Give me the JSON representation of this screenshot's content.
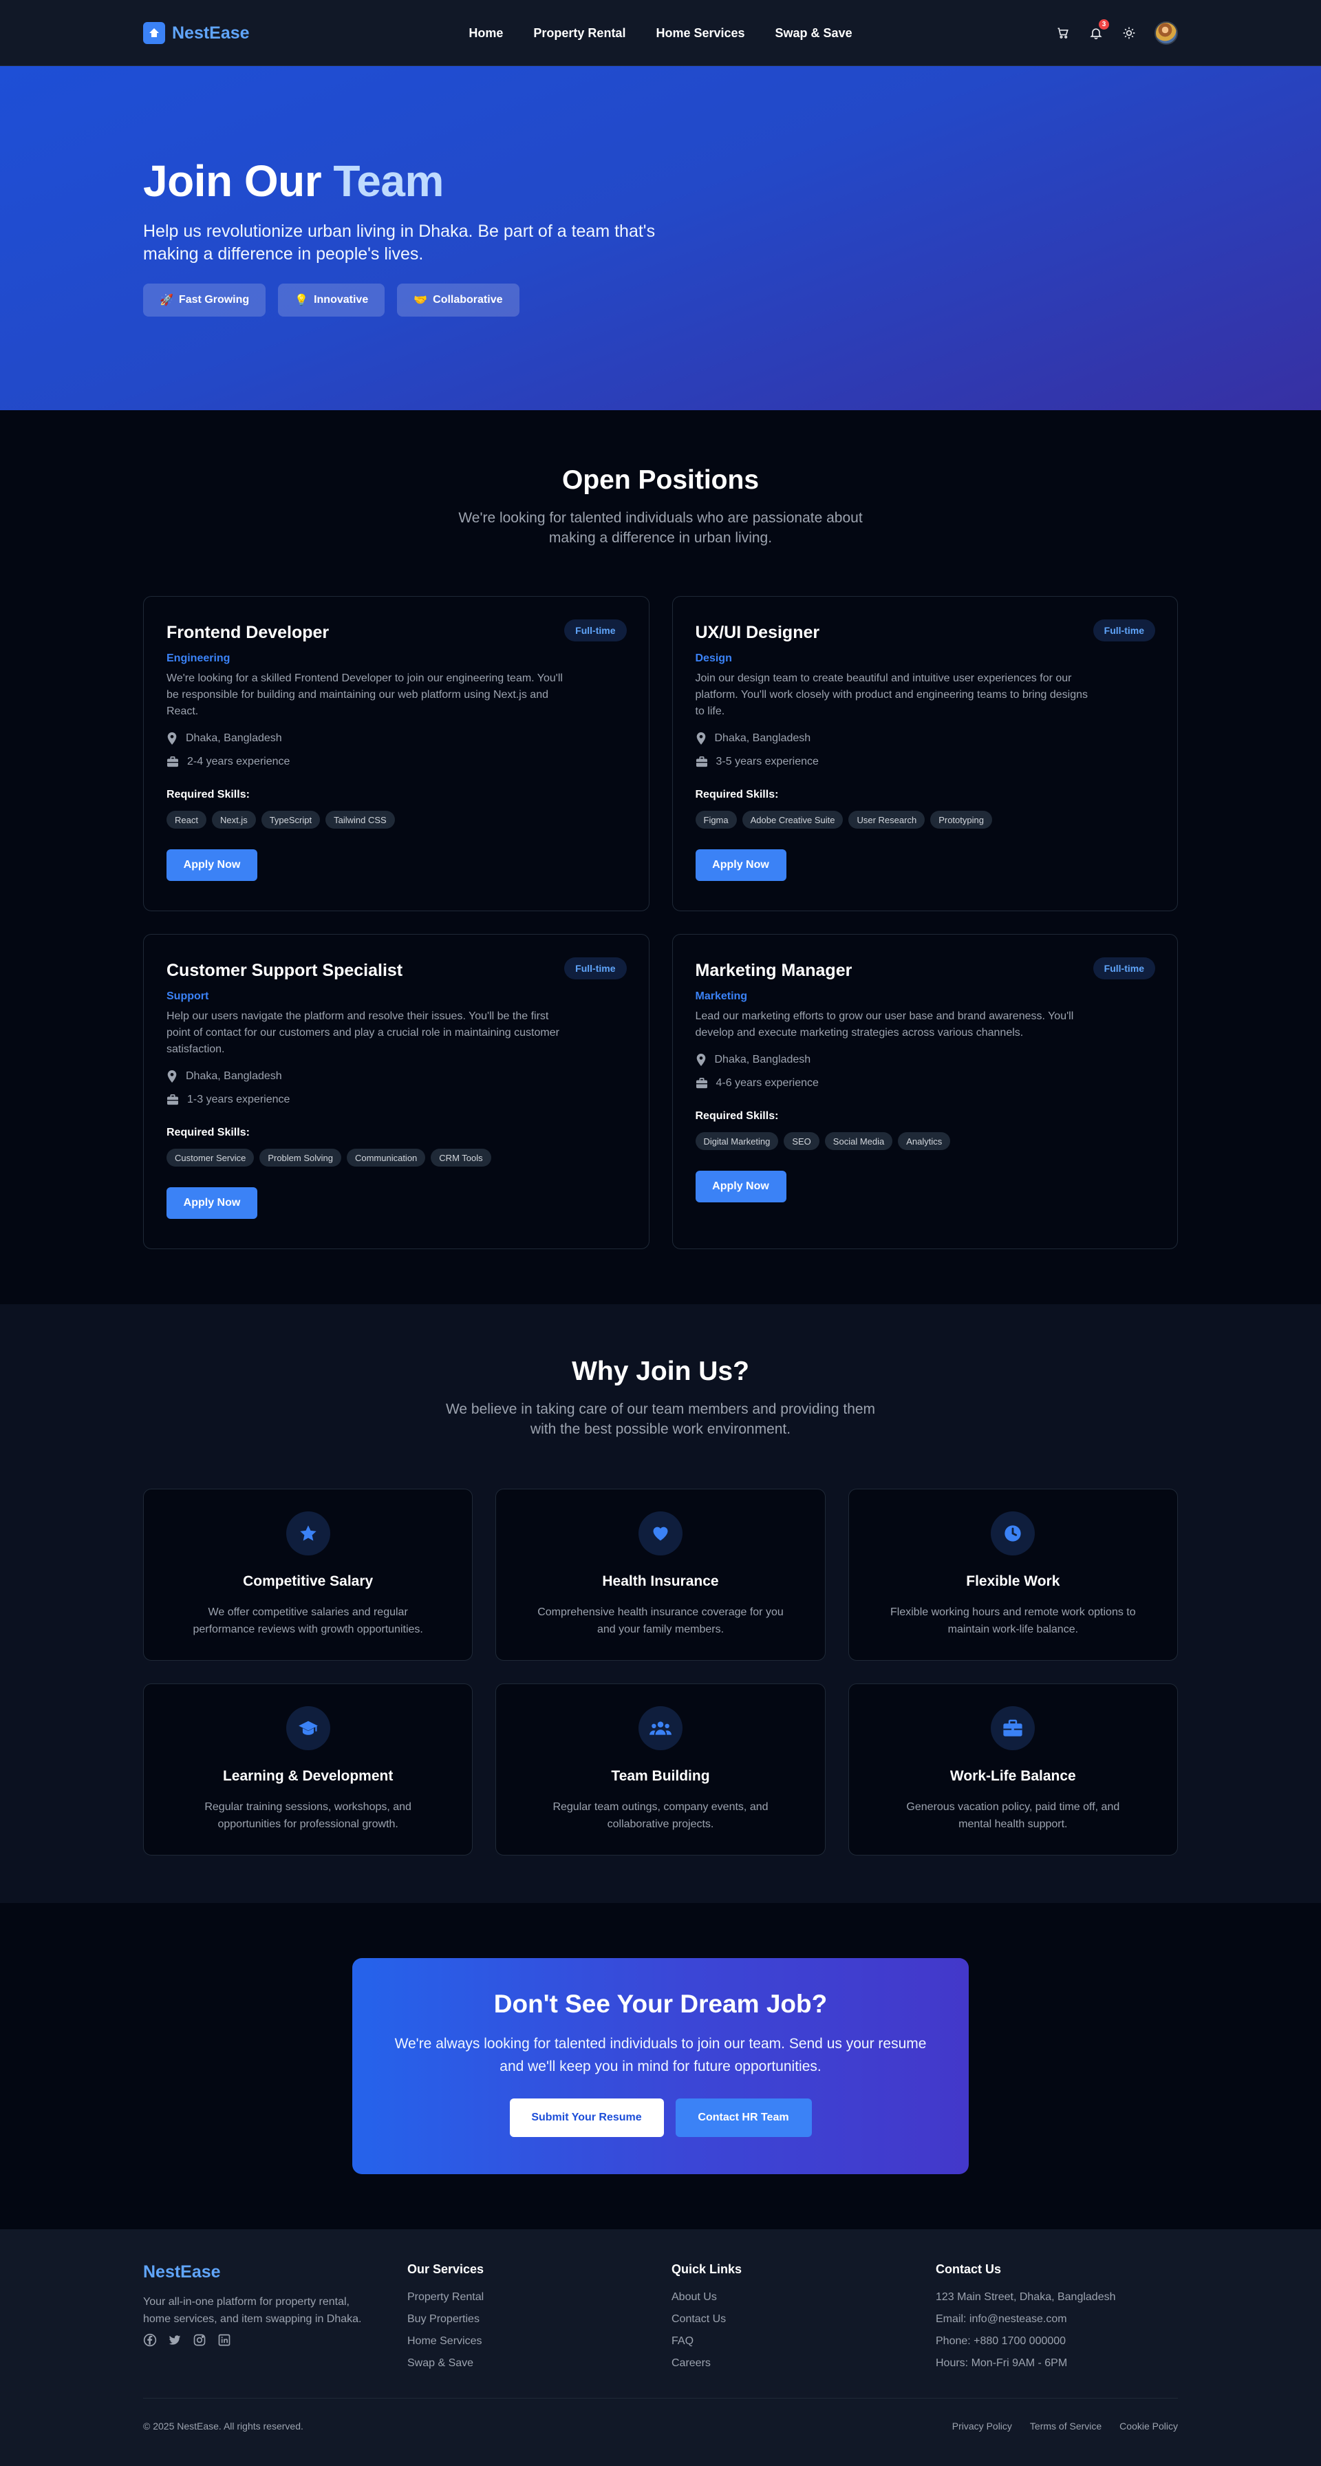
{
  "nav": {
    "brand": "NestEase",
    "links": [
      "Home",
      "Property Rental",
      "Home Services",
      "Swap & Save"
    ],
    "notification_count": "3",
    "icons": [
      "cart-icon",
      "bell-icon",
      "sun-icon",
      "avatar"
    ]
  },
  "hero": {
    "title_main": "Join Our",
    "title_accent": "Team",
    "subtitle": "Help us revolutionize urban living in Dhaka. Be part of a team that's making a difference in people's lives.",
    "chips": [
      {
        "emoji": "🚀",
        "label": "Fast Growing"
      },
      {
        "emoji": "💡",
        "label": "Innovative"
      },
      {
        "emoji": "🤝",
        "label": "Collaborative"
      }
    ]
  },
  "positions": {
    "title": "Open Positions",
    "subtitle": "We're looking for talented individuals who are passionate about making a difference in urban living.",
    "skills_label": "Required Skills:",
    "apply_label": "Apply Now",
    "jobs": [
      {
        "title": "Frontend Developer",
        "type": "Full-time",
        "department": "Engineering",
        "description": "We're looking for a skilled Frontend Developer to join our engineering team. You'll be responsible for building and maintaining our web platform using Next.js and React.",
        "location": "Dhaka, Bangladesh",
        "experience": "2-4 years experience",
        "skills": [
          "React",
          "Next.js",
          "TypeScript",
          "Tailwind CSS"
        ]
      },
      {
        "title": "UX/UI Designer",
        "type": "Full-time",
        "department": "Design",
        "description": "Join our design team to create beautiful and intuitive user experiences for our platform. You'll work closely with product and engineering teams to bring designs to life.",
        "location": "Dhaka, Bangladesh",
        "experience": "3-5 years experience",
        "skills": [
          "Figma",
          "Adobe Creative Suite",
          "User Research",
          "Prototyping"
        ]
      },
      {
        "title": "Customer Support Specialist",
        "type": "Full-time",
        "department": "Support",
        "description": "Help our users navigate the platform and resolve their issues. You'll be the first point of contact for our customers and play a crucial role in maintaining customer satisfaction.",
        "location": "Dhaka, Bangladesh",
        "experience": "1-3 years experience",
        "skills": [
          "Customer Service",
          "Problem Solving",
          "Communication",
          "CRM Tools"
        ]
      },
      {
        "title": "Marketing Manager",
        "type": "Full-time",
        "department": "Marketing",
        "description": "Lead our marketing efforts to grow our user base and brand awareness. You'll develop and execute marketing strategies across various channels.",
        "location": "Dhaka, Bangladesh",
        "experience": "4-6 years experience",
        "skills": [
          "Digital Marketing",
          "SEO",
          "Social Media",
          "Analytics"
        ]
      }
    ]
  },
  "why": {
    "title": "Why Join Us?",
    "subtitle": "We believe in taking care of our team members and providing them with the best possible work environment.",
    "benefits": [
      {
        "icon": "star-icon",
        "title": "Competitive Salary",
        "text": "We offer competitive salaries and regular performance reviews with growth opportunities."
      },
      {
        "icon": "heart-icon",
        "title": "Health Insurance",
        "text": "Comprehensive health insurance coverage for you and your family members."
      },
      {
        "icon": "clock-icon",
        "title": "Flexible Work",
        "text": "Flexible working hours and remote work options to maintain work-life balance."
      },
      {
        "icon": "graduation-cap-icon",
        "title": "Learning & Development",
        "text": "Regular training sessions, workshops, and opportunities for professional growth."
      },
      {
        "icon": "users-icon",
        "title": "Team Building",
        "text": "Regular team outings, company events, and collaborative projects."
      },
      {
        "icon": "briefcase-icon",
        "title": "Work-Life Balance",
        "text": "Generous vacation policy, paid time off, and mental health support."
      }
    ]
  },
  "cta": {
    "title": "Don't See Your Dream Job?",
    "text": "We're always looking for talented individuals to join our team. Send us your resume and we'll keep you in mind for future opportunities.",
    "primary": "Submit Your Resume",
    "secondary": "Contact HR Team"
  },
  "footer": {
    "brand": "NestEase",
    "about": "Your all-in-one platform for property rental, home services, and item swapping in Dhaka.",
    "socials": [
      "facebook-icon",
      "twitter-icon",
      "instagram-icon",
      "linkedin-icon"
    ],
    "services_title": "Our Services",
    "services": [
      "Property Rental",
      "Buy Properties",
      "Home Services",
      "Swap & Save"
    ],
    "links_title": "Quick Links",
    "links": [
      "About Us",
      "Contact Us",
      "FAQ",
      "Careers"
    ],
    "contact_title": "Contact Us",
    "contact": [
      "123 Main Street, Dhaka, Bangladesh",
      "Email: info@nestease.com",
      "Phone: +880 1700 000000",
      "Hours: Mon-Fri 9AM - 6PM"
    ],
    "copyright": "© 2025 NestEase. All rights reserved.",
    "legal": [
      "Privacy Policy",
      "Terms of Service",
      "Cookie Policy"
    ]
  },
  "colors": {
    "accent": "#3b82f6",
    "brand_text": "#60a5fa",
    "background": "#030712",
    "badge": "#ef4444"
  }
}
